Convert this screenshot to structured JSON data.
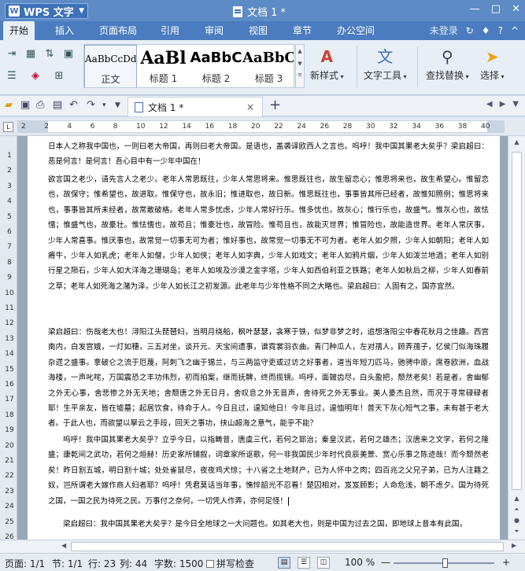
{
  "titlebar": {
    "app_name": "WPS 文字",
    "doc_title": "文档 1 *",
    "min": "—",
    "max": "□",
    "close": "✕"
  },
  "menubar": {
    "tabs": [
      "开始",
      "插入",
      "页面布局",
      "引用",
      "审阅",
      "视图",
      "章节",
      "办公空间"
    ],
    "active_tab": "开始",
    "login": "未登录"
  },
  "ribbon": {
    "styles": [
      {
        "preview": "AaBbCcDd",
        "name": "正文"
      },
      {
        "preview": "AaBl",
        "name": "标题 1"
      },
      {
        "preview": "AaBbC",
        "name": "标题 2"
      },
      {
        "preview": "AaBbC",
        "name": "标题 3"
      }
    ],
    "new_style": "新样式",
    "text_tools": "文字工具",
    "find_replace": "查找替换",
    "select": "选择"
  },
  "tabbar": {
    "doc_tab": "文档 1 *",
    "close": "×",
    "add": "+"
  },
  "ruler": {
    "h_ticks": [
      "2",
      "2",
      "4",
      "6",
      "8",
      "10",
      "12",
      "14",
      "16",
      "18",
      "20",
      "22",
      "24",
      "26",
      "28",
      "30",
      "32",
      "34",
      "36",
      "38",
      "40"
    ],
    "v_ticks": [
      "1",
      "2",
      "3",
      "4",
      "5",
      "6",
      "7",
      "8",
      "9",
      "10",
      "11",
      "12",
      "13",
      "14",
      "15",
      "16",
      "17",
      "18",
      "19",
      "20",
      "21",
      "22",
      "23",
      "24",
      "25",
      "26"
    ]
  },
  "document": {
    "paragraphs": [
      "日本人之称我中国也，一则曰老大帝国，再则曰老大帝国。是语也，盖袭译欧西人之言也。呜呼！我中国其果老大矣乎？梁启超曰：恶是何言！是何言！吾心目中有一少年中国在！",
      "欲言国之老少，请先言人之老少。老年人常思既往，少年人常思将来。惟思既往也，故生留恋心；惟思将来也，故生希望心。惟留恋也，故保守；惟希望也，故进取。惟保守也，故永旧；惟进取也，故日新。惟思既往也，事事皆其所已经者，故惟知照例；惟思将来也，事事皆其所未经者，故常敢破格。老年人常多忧虑，少年人常好行乐。惟多忧也，故灰心；惟行乐也，故盛气。惟灰心也，故怯懦；惟盛气也，故豪壮。惟怯懦也，故苟且；惟豪壮也，故冒险。惟苟且也，故能灭世界；惟冒险也，故能造世界。老年人常厌事，少年人常喜事。惟厌事也，故常觉一切事无可为者；惟好事也，故常觉一切事无不可为者。老年人如夕照，少年人如朝阳；老年人如瘠牛，少年人如乳虎；老年人如僧，少年人如侠；老年人如字典，少年人如戏文；老年人如鸦片烟，少年人如泼兰地酒；老年人如别行星之陨石，少年人如大洋海之珊瑚岛；老年人如埃及沙漠之金字塔，少年人如西伯利亚之铁路；老年人如秋后之柳，少年人如春前之草；老年人如死海之潴为泽，少年人如长江之初发源。此老年与少年性格不同之大略也。梁启超曰：人固有之，国亦宜然。",
      "梁启超曰：伤哉老大也！浔阳江头琵琶妇，当明月绕船，枫叶瑟瑟，衾寒于铁，似梦非梦之时，追想洛阳尘中春花秋月之佳趣。西宫南内，白发宫娥，一灯如穗，三五对坐，谈开元、天宝间遗事，谱霓裳羽衣曲。青门种瓜人，左对孺人，顾弄孺子，忆侯门似海珠履杂遝之盛事。拿破仑之流于厄蔑，阿刺飞之幽于锡兰，与三两监守吏或过访之好事者，道当年短刀匹马，驰骋中原，席卷欧洲，血战海楼，一声叱咤，万国震恐之丰功伟烈，初而拍案，继而抚髀，终而揽镜。呜呼，面皴齿尽，白头盈把，颓然老矣！若是者，舍幽郁之外无心事，舍悲惨之外无天地；舍颓唐之外无日月，舍叹息之外无音声，舍待死之外无事业。美人豪杰且然，而况于寻常碌碌者耶！生平亲友，皆在墟墓；起居饮食，待命于人。今日且过，遑知他日！今年且过，遑恤明年！普天下灰心短气之事，未有甚于老大者。于此人也，而欲望以拏云之手段，回天之事功，挟山超海之意气，能乎不能？",
      "呜呼！我中国其果老大矣乎？立乎今日，以指畴昔，唐虞三代，若何之郅治；秦皇汉武，若何之雄杰；汉唐来之文学，若何之隆盛；康乾间之武功，若何之烜赫！历史家所铺叙，词章家所讴歌，何一非我国民少年时代良辰美景、赏心乐事之陈迹哉！而今颓然老矣！昨日割五城，明日割十城；处处雀鼠尽，夜夜鸡犬惊；十八省之土地财产，已为人怀中之肉；四百兆之父兄子弟，已为人注籍之奴，岂所谓老大嫁作商人妇者耶？呜呼！凭君莫话当年事，憔悴韶光不忍看！楚囚相对，岌岌顾影；人命危浅，朝不虑夕。国为待死之国，一国之民为待死之民。万事付之奈何，一切凭人作弄，亦何足怪！",
      "梁启超曰：我中国其果老大矣乎？是今日全地球之一大问题也。如其老大也，则是中国为过去之国，即地球上昔本有此国，"
    ]
  },
  "status": {
    "page": "页面: 1/1",
    "section": "节: 1/1",
    "row": "行: 23",
    "col": "列: 44",
    "words": "字数: 1500",
    "spell": "拼写检查",
    "zoom": "100 %",
    "minus": "—",
    "plus": "+"
  }
}
